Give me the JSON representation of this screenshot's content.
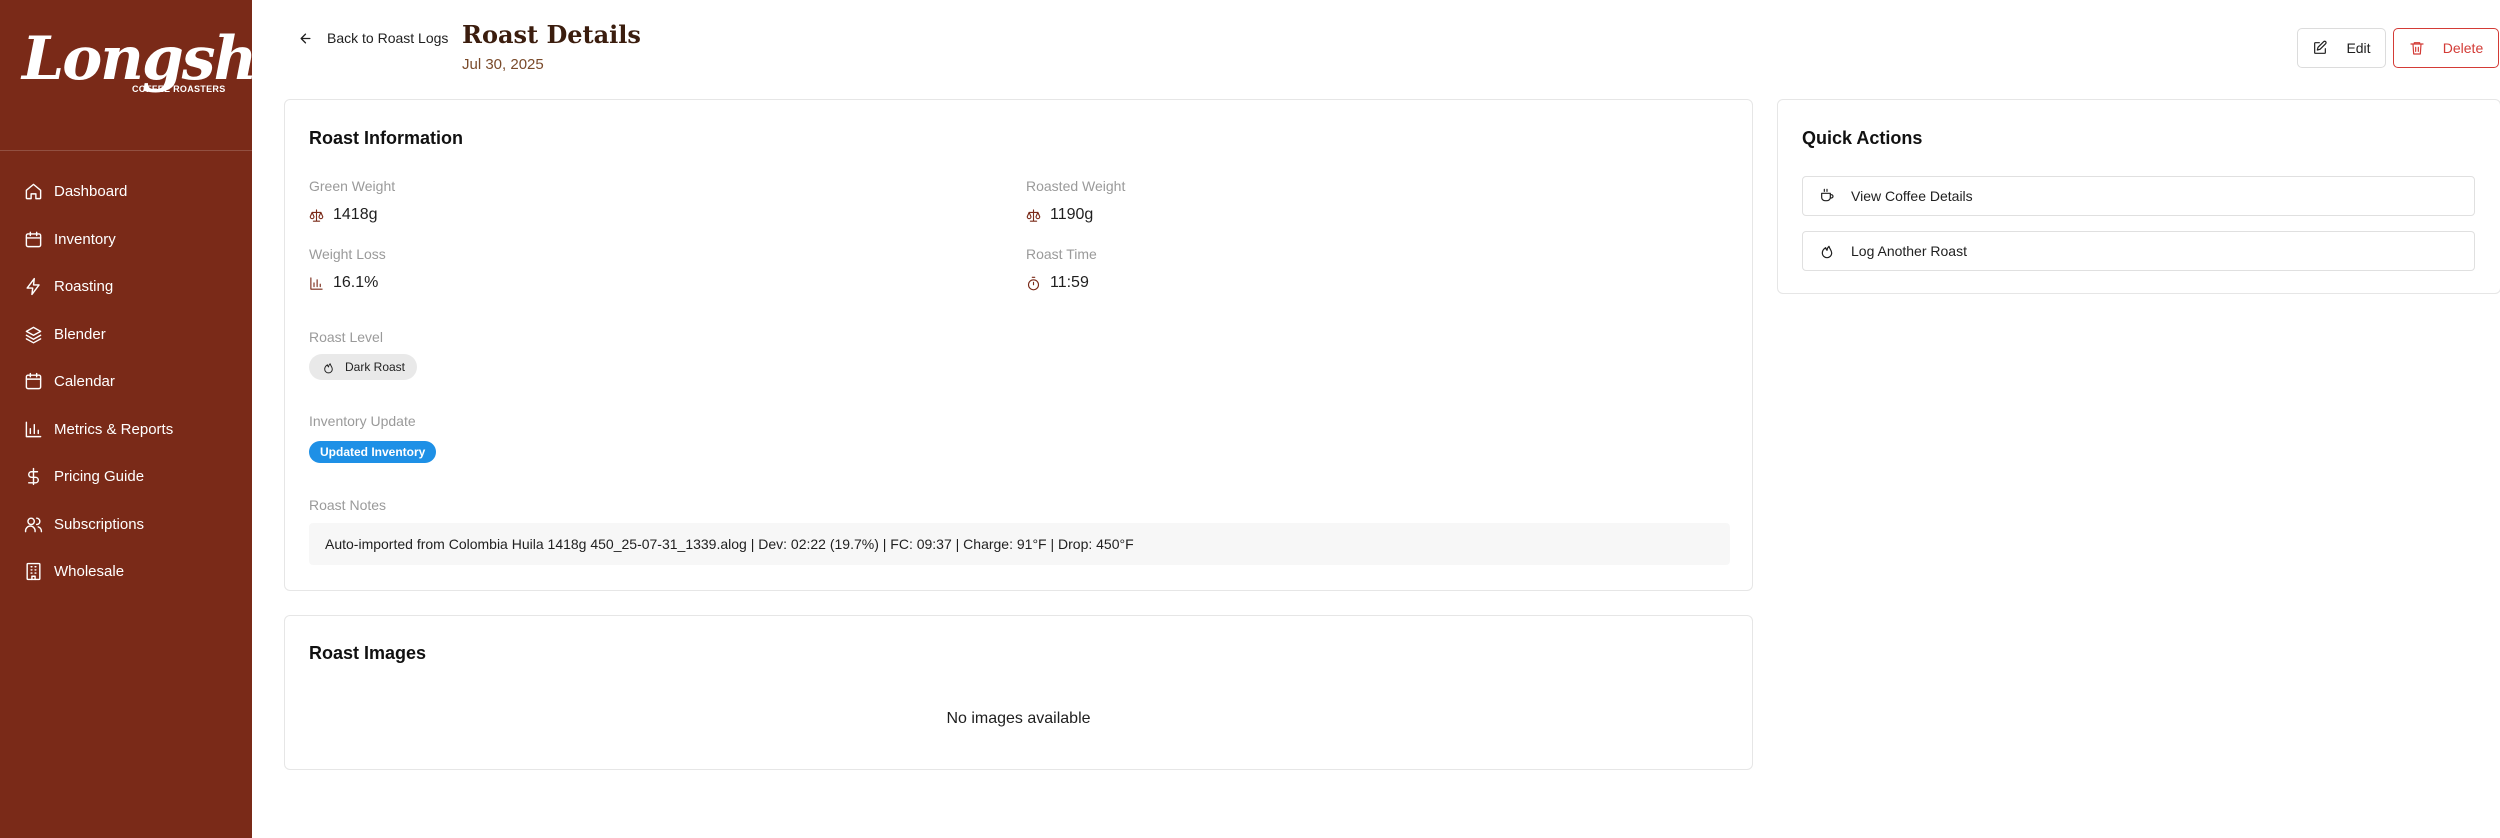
{
  "brand": {
    "name": "Longshot",
    "subtitle": "COFFEE ROASTERS"
  },
  "sidebar": {
    "items": [
      {
        "label": "Dashboard",
        "icon": "home-icon"
      },
      {
        "label": "Inventory",
        "icon": "calendar-box-icon"
      },
      {
        "label": "Roasting",
        "icon": "lightning-icon"
      },
      {
        "label": "Blender",
        "icon": "layers-icon"
      },
      {
        "label": "Calendar",
        "icon": "calendar-icon"
      },
      {
        "label": "Metrics & Reports",
        "icon": "bar-chart-icon"
      },
      {
        "label": "Pricing Guide",
        "icon": "dollar-icon"
      },
      {
        "label": "Subscriptions",
        "icon": "users-icon"
      },
      {
        "label": "Wholesale",
        "icon": "building-icon"
      }
    ]
  },
  "header": {
    "back_label": "Back to Roast Logs",
    "title": "Roast Details",
    "date": "Jul 30, 2025",
    "edit_label": "Edit",
    "delete_label": "Delete"
  },
  "roast_info": {
    "title": "Roast Information",
    "green_weight_label": "Green Weight",
    "green_weight": "1418g",
    "roasted_weight_label": "Roasted Weight",
    "roasted_weight": "1190g",
    "weight_loss_label": "Weight Loss",
    "weight_loss": "16.1%",
    "roast_time_label": "Roast Time",
    "roast_time": "11:59",
    "roast_level_label": "Roast Level",
    "roast_level": "Dark Roast",
    "inventory_update_label": "Inventory Update",
    "inventory_update": "Updated Inventory",
    "notes_label": "Roast Notes",
    "notes": "Auto-imported from Colombia Huila 1418g 450_25-07-31_1339.alog | Dev: 02:22 (19.7%) | FC: 09:37 | Charge: 91°F | Drop: 450°F"
  },
  "quick_actions": {
    "title": "Quick Actions",
    "view_coffee_label": "View Coffee Details",
    "log_roast_label": "Log Another Roast"
  },
  "roast_images": {
    "title": "Roast Images",
    "empty_text": "No images available"
  },
  "colors": {
    "sidebar_bg": "#7a2a18",
    "title_brown": "#3b1d0e",
    "delete_red": "#d33b36",
    "badge_blue": "#1e90e6"
  }
}
